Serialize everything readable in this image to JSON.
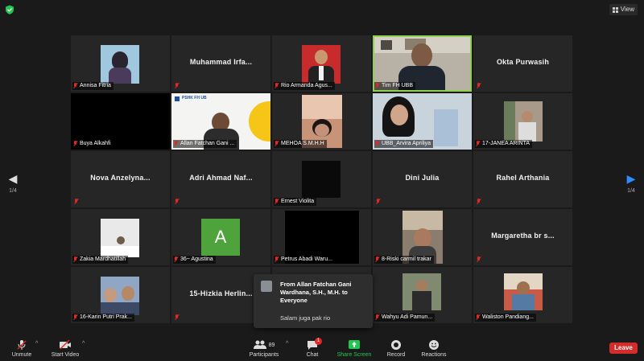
{
  "top": {
    "view_label": "View"
  },
  "nav": {
    "left_page": "1/4",
    "right_page": "1/4"
  },
  "tiles": [
    {
      "label": "Annisa Fitria",
      "big": ""
    },
    {
      "label": "",
      "big": "Muhammad Irfa..."
    },
    {
      "label": "Rio Armanda Agus...",
      "big": ""
    },
    {
      "label": "Tim FH UBB",
      "big": ""
    },
    {
      "label": "",
      "big": "Okta Purwasih"
    },
    {
      "label": "Buya Alkahfi",
      "big": ""
    },
    {
      "label": "Allan Fatchan Gani ...",
      "big": ""
    },
    {
      "label": "MEHOA S.M.H.H",
      "big": ""
    },
    {
      "label": "UBB_Arvira Apriliya",
      "big": ""
    },
    {
      "label": "17-JANEA ARINTA",
      "big": ""
    },
    {
      "label": "",
      "big": "Nova Anzelyna..."
    },
    {
      "label": "",
      "big": "Adri Ahmad Naf..."
    },
    {
      "label": "Ernest Violita",
      "big": ""
    },
    {
      "label": "",
      "big": "Dini Julia"
    },
    {
      "label": "",
      "big": "Rahel Arthania"
    },
    {
      "label": "Zakia Mardhatillah",
      "big": ""
    },
    {
      "label": "36~ Agustina",
      "big": "",
      "avatar_letter": "A"
    },
    {
      "label": "Petrus Abadi Waru...",
      "big": ""
    },
    {
      "label": "8-Riski carmil trakar",
      "big": ""
    },
    {
      "label": "",
      "big": "Margaretha br s..."
    },
    {
      "label": "16-Karin Putri Prak...",
      "big": ""
    },
    {
      "label": "",
      "big": "15-Hizkia Herlin..."
    },
    {
      "label": "",
      "big": ""
    },
    {
      "label": "Wahyu Adi Pamun...",
      "big": ""
    },
    {
      "label": "Waliston Pandiang...",
      "big": ""
    }
  ],
  "slide": {
    "header": "PSHK FH UB"
  },
  "chat_popup": {
    "from": "From Allan Fatchan Gani Wardhana, S.H., M.H. to Everyone",
    "message": "Salam juga pak rio"
  },
  "toolbar": {
    "unmute": "Unmute",
    "start_video": "Start Video",
    "participants": "Participants",
    "participants_count": "89",
    "chat": "Chat",
    "chat_badge": "1",
    "share_screen": "Share Screen",
    "record": "Record",
    "reactions": "Reactions",
    "leave": "Leave"
  },
  "colors": {
    "active_speaker": "#8fd14f",
    "share_green": "#23c552",
    "leave_red": "#d42b2b",
    "muted_red": "#e02828",
    "nav_blue": "#2d8cff"
  }
}
